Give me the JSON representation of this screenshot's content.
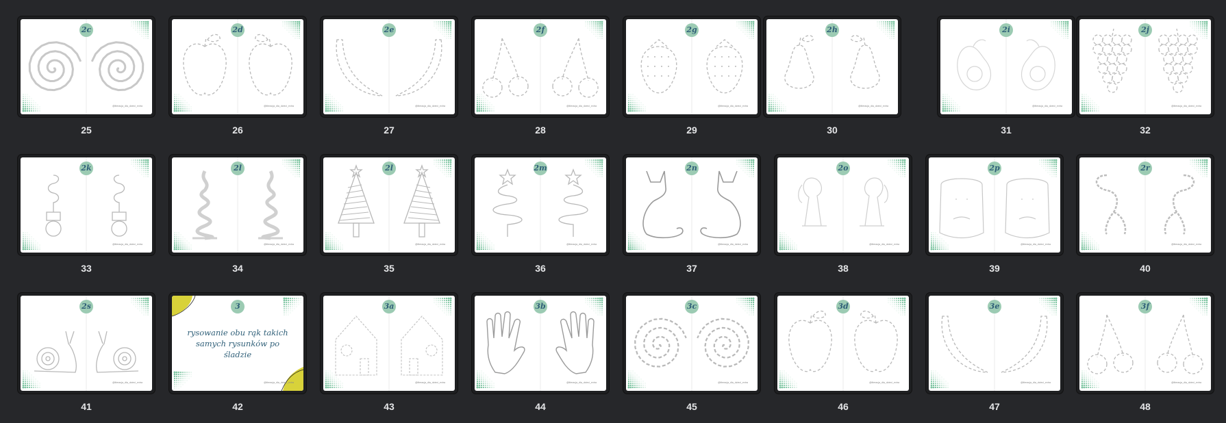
{
  "app": {
    "view": "page thumbnail grid"
  },
  "handle_text": "@literacja_dla_dzieci_extra",
  "colors": {
    "background": "#26272a",
    "badge": "#9ccbb3",
    "badge_text": "#2f5f78",
    "dots": "#7cc4a0",
    "cover_accent": "#d8d23a"
  },
  "pages": [
    {
      "number": "25",
      "badge": "2c",
      "shape": "spiral"
    },
    {
      "number": "26",
      "badge": "2d",
      "shape": "apple"
    },
    {
      "number": "27",
      "badge": "2e",
      "shape": "banana"
    },
    {
      "number": "28",
      "badge": "2f",
      "shape": "cherries"
    },
    {
      "number": "29",
      "badge": "2g",
      "shape": "strawberry"
    },
    {
      "number": "30",
      "badge": "2h",
      "shape": "pear"
    },
    {
      "number": "31",
      "badge": "2i",
      "shape": "avocado"
    },
    {
      "number": "32",
      "badge": "2j",
      "shape": "grapes"
    },
    {
      "number": "33",
      "badge": "2k",
      "shape": "lightbulb"
    },
    {
      "number": "34",
      "badge": "2l",
      "shape": "tree-wavy"
    },
    {
      "number": "35",
      "badge": "2l",
      "shape": "tree-striped"
    },
    {
      "number": "36",
      "badge": "2m",
      "shape": "tree-loops"
    },
    {
      "number": "37",
      "badge": "2n",
      "shape": "cat"
    },
    {
      "number": "38",
      "badge": "2o",
      "shape": "dog"
    },
    {
      "number": "39",
      "badge": "2p",
      "shape": "capybara"
    },
    {
      "number": "40",
      "badge": "2r",
      "shape": "lemur"
    },
    {
      "number": "41",
      "badge": "2s",
      "shape": "snail"
    },
    {
      "number": "42",
      "badge": "3",
      "shape": "cover",
      "cover_text": "rysowanie obu rąk takich samych rysunków po śladzie"
    },
    {
      "number": "43",
      "badge": "3a",
      "shape": "house"
    },
    {
      "number": "44",
      "badge": "3b",
      "shape": "hand"
    },
    {
      "number": "45",
      "badge": "3c",
      "shape": "spiral-dashed"
    },
    {
      "number": "46",
      "badge": "3d",
      "shape": "apple"
    },
    {
      "number": "47",
      "badge": "3e",
      "shape": "banana"
    },
    {
      "number": "48",
      "badge": "3f",
      "shape": "cherries"
    }
  ]
}
